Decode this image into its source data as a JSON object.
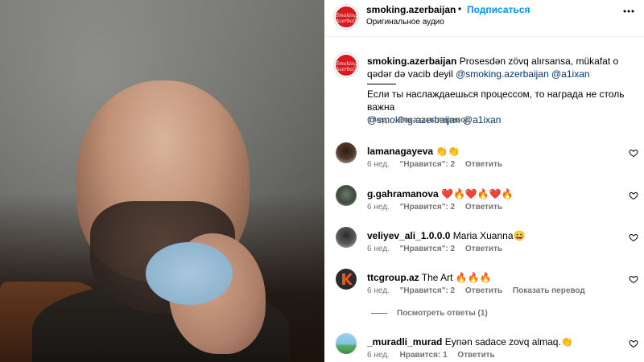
{
  "post": {
    "author": "smoking.azerbaijan",
    "dot": "•",
    "follow_label": "Подписаться",
    "audio_label": "Оригинальное аудио",
    "more_icon": "more-horizontal-icon",
    "media_alt": "Bald bearded man with hand to mouth, face area blurred"
  },
  "brand": {
    "logo_text": "Smoking\nAzerbaijan",
    "logo_color": "#d8191f",
    "link_color": "#00376b",
    "accent": "#0095f6"
  },
  "caption": {
    "username": "smoking.azerbaijan",
    "text_az": "Prosesdən zövq alırsansa, mükafat o qədər də vacib deyil",
    "mention1": "@smoking.azerbaijan",
    "mention2": "@a1ixan",
    "text_ru": "Если ты наслаждаешься процессом, то награда не столь важна",
    "time": "6 нед.",
    "translate": "Показать перевод"
  },
  "comments": [
    {
      "username": "lamanagayeva",
      "text": "👏👏",
      "time": "6 нед.",
      "likes": "\"Нравится\": 2",
      "reply": "Ответить",
      "translate": ""
    },
    {
      "username": "g.gahramanova",
      "text": "❤️🔥❤️🔥❤️🔥",
      "time": "6 нед.",
      "likes": "\"Нравится\": 2",
      "reply": "Ответить",
      "translate": ""
    },
    {
      "username": "veliyev_ali_1.0.0.0",
      "text": "Maria Xuanna😄",
      "time": "6 нед.",
      "likes": "\"Нравится\": 2",
      "reply": "Ответить",
      "translate": ""
    },
    {
      "username": "ttcgroup.az",
      "text": "The Art 🔥🔥🔥",
      "time": "6 нед.",
      "likes": "\"Нравится\": 2",
      "reply": "Ответить",
      "translate": "Показать перевод"
    },
    {
      "username": "_muradli_murad",
      "text": "Eynən sadace zovq almaq.👏",
      "time": "6 нед.",
      "likes": "Нравится: 1",
      "reply": "Ответить",
      "translate": ""
    }
  ],
  "view_replies": "Посмотреть ответы (1)"
}
